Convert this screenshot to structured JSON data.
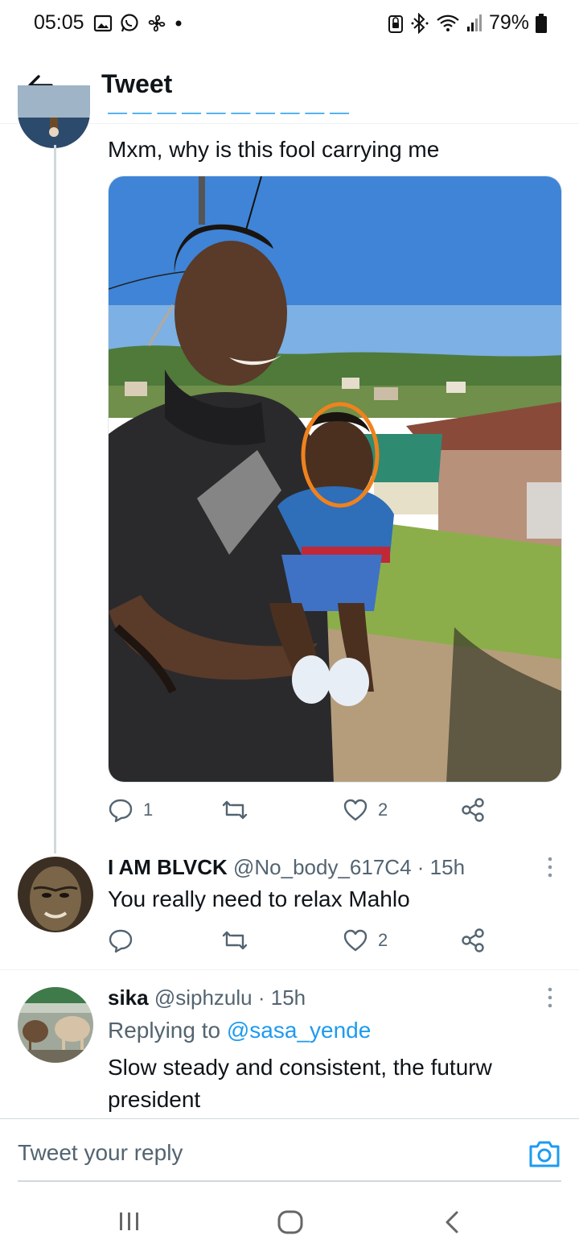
{
  "status_bar": {
    "time": "05:05",
    "battery": "79%",
    "left_icons": [
      "gallery-icon",
      "whatsapp-icon",
      "fan-icon",
      "dot-icon"
    ],
    "right_icons": [
      "lock-icon",
      "bluetooth-icon",
      "wifi-icon",
      "signal-icon",
      "battery-icon"
    ]
  },
  "header": {
    "title": "Tweet",
    "back_icon": "arrow-left-icon"
  },
  "parent_tweet": {
    "text": "Mxm, why is this fool carrying me",
    "actions": {
      "reply_count": "1",
      "retweet_count": "",
      "like_count": "2"
    }
  },
  "reply_1": {
    "name": "I AM BLVCK",
    "handle": "@No_body_617C4",
    "time": "· 15h",
    "text": "You really need to relax Mahlo",
    "actions": {
      "reply_count": "",
      "retweet_count": "",
      "like_count": "2"
    }
  },
  "reply_2": {
    "name": "sika",
    "handle": "@siphzulu",
    "time": "· 15h",
    "replying_prefix": "Replying to",
    "replying_handle": "@sasa_yende",
    "text_line1": "Slow steady and consistent, the futurw",
    "text_line2": "president"
  },
  "composer": {
    "placeholder": "Tweet your reply"
  },
  "colors": {
    "accent": "#1d9bf0",
    "secondary_text": "#536471",
    "primary_text": "#0f1419",
    "highlight_circle": "#f0821e"
  }
}
